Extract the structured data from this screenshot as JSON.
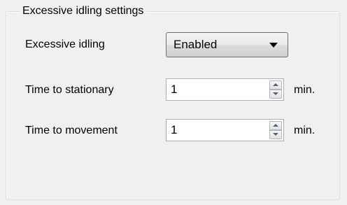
{
  "group": {
    "title": "Excessive idling settings"
  },
  "excessive_idling": {
    "label": "Excessive idling",
    "selected_value": "Enabled"
  },
  "time_to_stationary": {
    "label": "Time to stationary",
    "value": "1",
    "unit": "min."
  },
  "time_to_movement": {
    "label": "Time to movement",
    "value": "1",
    "unit": "min."
  }
}
